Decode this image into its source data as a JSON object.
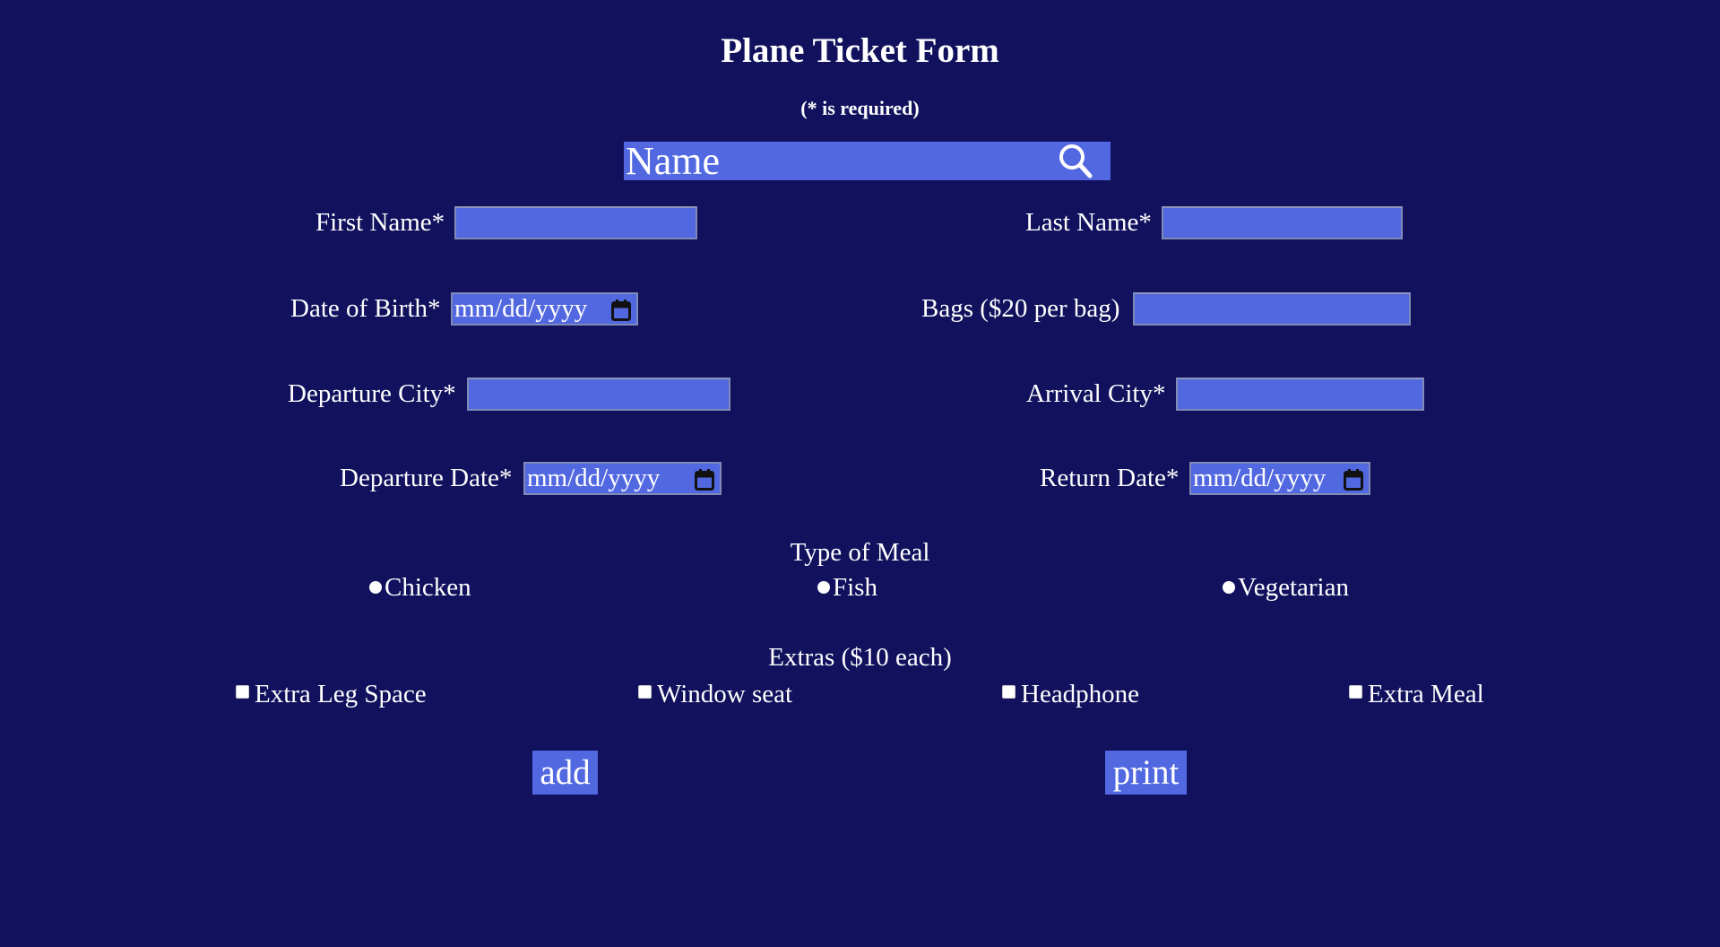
{
  "header": {
    "title": "Plane Ticket Form",
    "subtitle": "(* is required)"
  },
  "search": {
    "placeholder": "Name",
    "icon": "search-icon"
  },
  "fields": {
    "first_name": {
      "label": "First Name*",
      "value": ""
    },
    "last_name": {
      "label": "Last Name*",
      "value": ""
    },
    "date_of_birth": {
      "label": "Date of Birth*",
      "placeholder": "mm/dd/yyyy"
    },
    "bags": {
      "label": "Bags ($20 per bag)",
      "value": ""
    },
    "departure_city": {
      "label": "Departure City*",
      "value": ""
    },
    "arrival_city": {
      "label": "Arrival City*",
      "value": ""
    },
    "departure_date": {
      "label": "Departure Date*",
      "placeholder": "mm/dd/yyyy"
    },
    "return_date": {
      "label": "Return Date*",
      "placeholder": "mm/dd/yyyy"
    }
  },
  "meal": {
    "title": "Type of Meal",
    "options": [
      "Chicken",
      "Fish",
      "Vegetarian"
    ],
    "selected": null
  },
  "extras": {
    "title": "Extras ($10 each)",
    "options": [
      "Extra Leg Space",
      "Window seat",
      "Headphone",
      "Extra Meal"
    ],
    "checked": [
      false,
      false,
      false,
      false
    ]
  },
  "buttons": {
    "add": "add",
    "print": "print"
  },
  "colors": {
    "background": "#11115e",
    "field": "#5268e0",
    "text": "#ffffff"
  }
}
